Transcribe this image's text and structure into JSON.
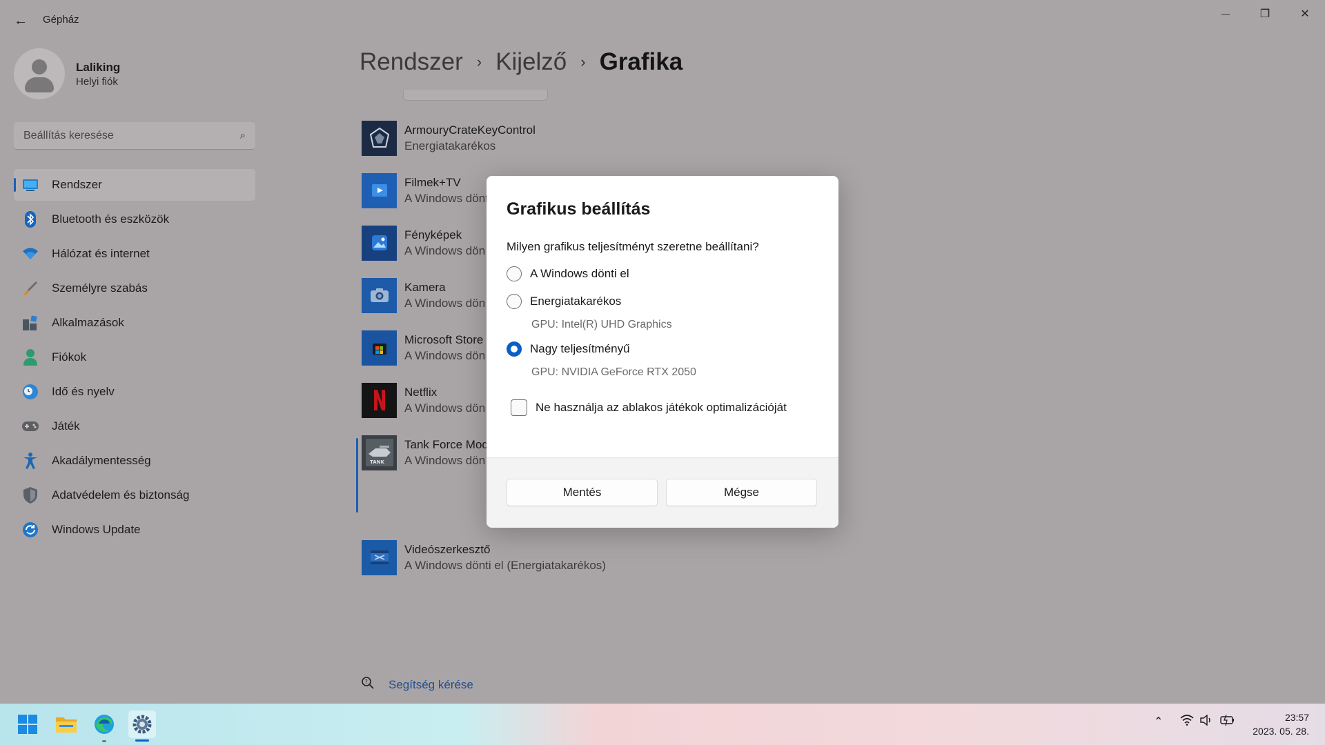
{
  "window": {
    "title": "Gépház",
    "back_icon": "←",
    "minimize_icon": "—",
    "maximize_icon": "❐",
    "close_icon": "✕"
  },
  "profile": {
    "name": "Laliking",
    "account_type": "Helyi fiók"
  },
  "search": {
    "placeholder": "Beállítás keresése",
    "icon": "⌕"
  },
  "sidebar": {
    "items": [
      {
        "label": "Rendszer",
        "icon": "system-icon",
        "active": true
      },
      {
        "label": "Bluetooth és eszközök",
        "icon": "bluetooth-icon"
      },
      {
        "label": "Hálózat és internet",
        "icon": "wifi-icon"
      },
      {
        "label": "Személyre szabás",
        "icon": "brush-icon"
      },
      {
        "label": "Alkalmazások",
        "icon": "apps-icon"
      },
      {
        "label": "Fiókok",
        "icon": "person-icon"
      },
      {
        "label": "Idő és nyelv",
        "icon": "globe-clock-icon"
      },
      {
        "label": "Játék",
        "icon": "gamepad-icon"
      },
      {
        "label": "Akadálymentesség",
        "icon": "accessibility-icon"
      },
      {
        "label": "Adatvédelem és biztonság",
        "icon": "shield-icon"
      },
      {
        "label": "Windows Update",
        "icon": "update-icon"
      }
    ]
  },
  "breadcrumb": {
    "items": [
      "Rendszer",
      "Kijelző",
      "Grafika"
    ],
    "separator": "›"
  },
  "apps": [
    {
      "name": "ArmouryCrateKeyControl",
      "sub": "Energiatakarékos"
    },
    {
      "name": "Filmek+TV",
      "sub": "A Windows dönt"
    },
    {
      "name": "Fényképek",
      "sub": "A Windows dön"
    },
    {
      "name": "Kamera",
      "sub": "A Windows dön"
    },
    {
      "name": "Microsoft Store",
      "sub": "A Windows dön"
    },
    {
      "name": "Netflix",
      "sub": "A Windows dön"
    },
    {
      "name": "Tank Force Mod",
      "sub": "A Windows dön"
    },
    {
      "name": "Videószerkesztő",
      "sub": "A Windows dönti el (Energiatakarékos)"
    }
  ],
  "help": {
    "label": "Segítség kérése",
    "icon": "help-icon"
  },
  "dialog": {
    "title": "Grafikus beállítás",
    "question": "Milyen grafikus teljesítményt szeretne beállítani?",
    "options": [
      {
        "label": "A Windows dönti el",
        "selected": false
      },
      {
        "label": "Energiatakarékos",
        "gpu": "GPU: Intel(R) UHD Graphics",
        "selected": false
      },
      {
        "label": "Nagy teljesítményű",
        "gpu": "GPU: NVIDIA GeForce RTX 2050",
        "selected": true
      }
    ],
    "checkbox_label": "Ne használja az ablakos játékok optimalizációját",
    "checkbox_checked": false,
    "save_label": "Mentés",
    "cancel_label": "Mégse"
  },
  "taskbar": {
    "apps": [
      "start-icon",
      "file-explorer-icon",
      "edge-icon",
      "settings-icon"
    ],
    "tray_chevron": "⌃",
    "time": "23:57",
    "date": "2023. 05. 28."
  },
  "colors": {
    "accent": "#0a5ec4",
    "dimmed_background": "#a9a5a7"
  }
}
